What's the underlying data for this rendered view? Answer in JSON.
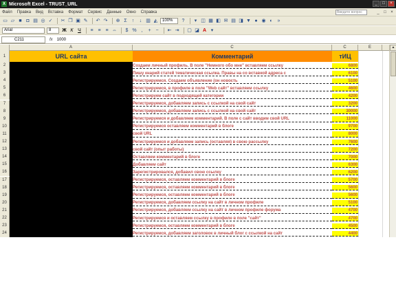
{
  "window": {
    "title": "Microsoft Excel - TRUST_URL",
    "buttons": [
      "_",
      "□",
      "×"
    ]
  },
  "menu": {
    "items": [
      "Файл",
      "Правка",
      "Вид",
      "Вставка",
      "Формат",
      "Сервис",
      "Данные",
      "Окно",
      "Справка"
    ],
    "help_placeholder": "Введите вопрос",
    "doc_buttons": [
      "_",
      "□",
      "×"
    ]
  },
  "toolbar": {
    "zoom": "100%",
    "font": "Arial",
    "size": "8",
    "bold": "Ж",
    "italic": "К",
    "underline": "Ч",
    "font_color": "A"
  },
  "formula_bar": {
    "name_box": "C211",
    "fx": "fx",
    "content": "1000"
  },
  "columns": [
    "A",
    "C",
    "C",
    "E"
  ],
  "header": {
    "url": "URL сайта",
    "comment": "Комментарий",
    "tic": "тИЦ"
  },
  "rows": [
    {
      "num": "2",
      "comment": "Создаем личный профиль. В поле \"Немного обо мне\" вставляем ссылку",
      "tic": "6800"
    },
    {
      "num": "3",
      "comment": "Пишу кнарий статей тематическая ссылка. Правы на со вставкой адреса с",
      "tic": "6100"
    },
    {
      "num": "4",
      "comment": "Регистрируемся. Создаем объявление (он новость",
      "tic": "5100"
    },
    {
      "num": "5",
      "comment": "Регистрируемся, в профиле в поле \"Web сайт\" вставляем ссылку",
      "tic": "4600"
    },
    {
      "num": "6",
      "comment": "Регистрируем сайт в подходящей категории",
      "tic": "4200"
    },
    {
      "num": "7",
      "comment": "Регистрируемся, добавляем запись с ссылкой на свой сайт",
      "tic": "3200"
    },
    {
      "num": "8",
      "comment": "Регистрируемся, добавляем запись с ссылкой на свой сайт",
      "tic": "30000"
    },
    {
      "num": "9",
      "comment": "Регистрируемся и добавляем комментарий. В поле с сайт вводим свой URL",
      "tic": "11000"
    },
    {
      "num": "10",
      "comment": "Регистрируемся оставляем комментарий в блоге",
      "tic": "9700"
    },
    {
      "num": "11",
      "comment": "свой URL",
      "tic": "8000"
    },
    {
      "num": "12",
      "comment": "Регистрируемся и добавляем запись (оставляя) в свою рассылку",
      "tic": "7600"
    },
    {
      "num": "13",
      "comment": "свой сайт (опыт работы)",
      "tic": "7200"
    },
    {
      "num": "14",
      "comment": "Оставляем комментарий в блоге",
      "tic": "7000"
    },
    {
      "num": "15",
      "comment": "Добавляем сайт",
      "tic": "6300"
    },
    {
      "num": "16",
      "comment": "Зарегистрировался, добавил свою ссылку",
      "tic": "6200"
    },
    {
      "num": "17",
      "comment": "Регистрируемся, оставляем комментарий в блоге",
      "tic": "5700"
    },
    {
      "num": "18",
      "comment": "Регистрируемся, оставляем комментарий в блоге",
      "tic": "5600"
    },
    {
      "num": "19",
      "comment": "Регистрируемся, оставляем комментарий в блоге",
      "tic": "5600"
    },
    {
      "num": "20",
      "comment": "Регистрируемся, добавляем ссылку на сайт в личном профиле",
      "tic": "5100"
    },
    {
      "num": "21",
      "comment": "Регистрируемся, добавляем ссылку на сайт в личном профиле форума",
      "tic": "4700"
    },
    {
      "num": "22",
      "comment": "Регистрируемся и оставляем ссылку в профиле в поле \"сайт\"",
      "tic": "4700"
    },
    {
      "num": "23",
      "comment": "Регистрируемся, оставляем комментарий в блоге",
      "tic": "4500"
    },
    {
      "num": "24",
      "comment": "Регистрируемся, добавляем заголовок в личный блог с ссылкой на сайт",
      "tic": "4400"
    }
  ]
}
